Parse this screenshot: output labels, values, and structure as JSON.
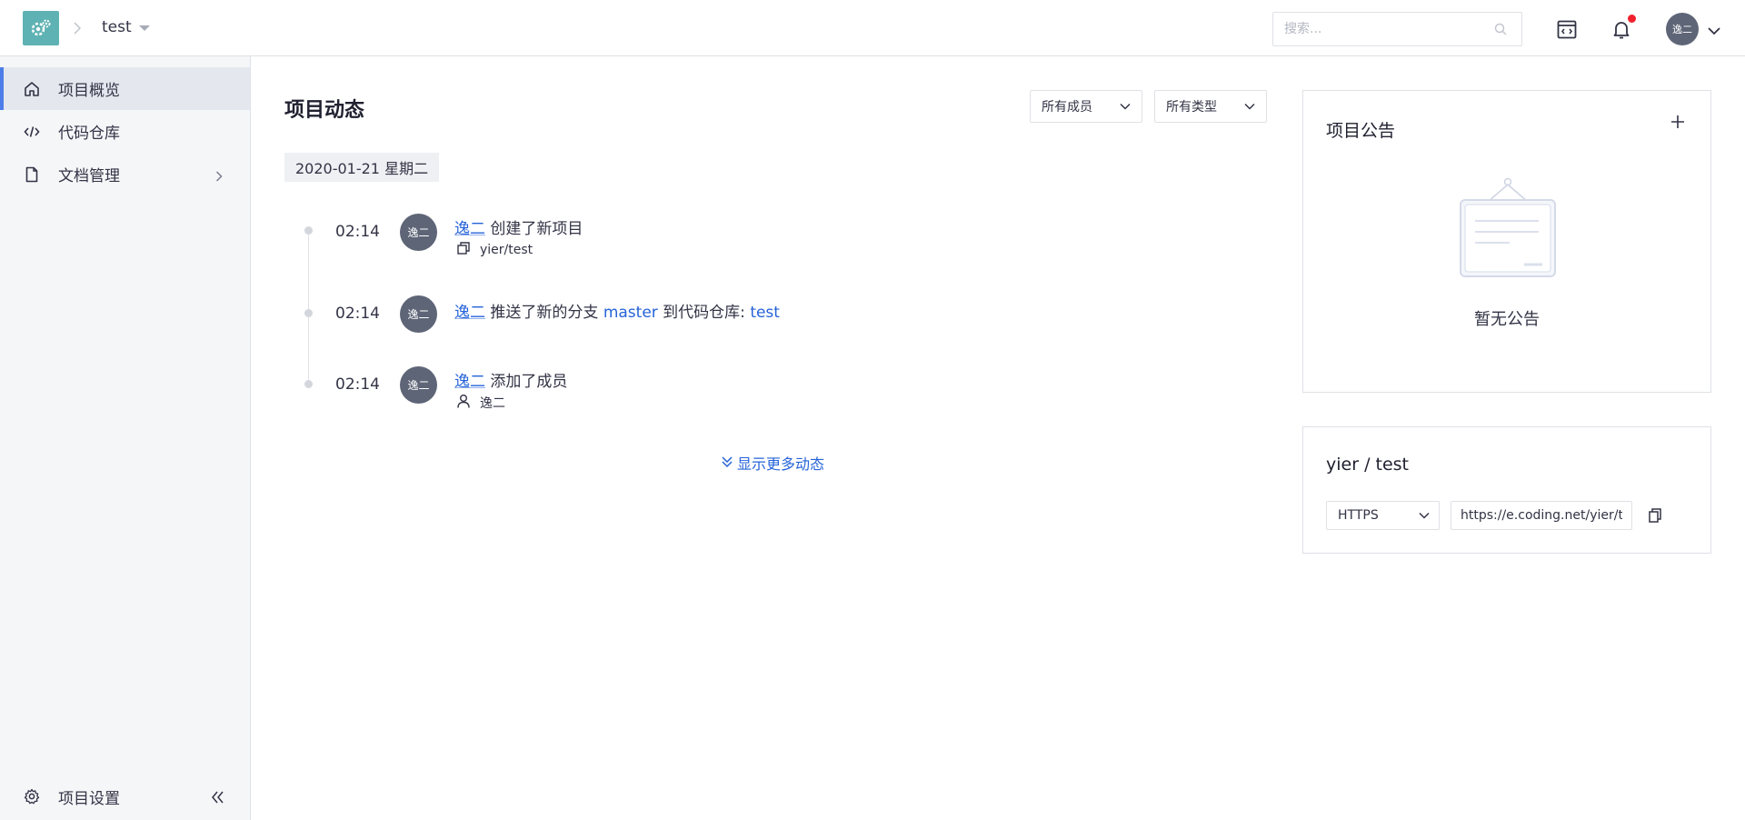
{
  "header": {
    "project_name": "test",
    "search_placeholder": "搜索...",
    "user_avatar": "逸二",
    "icons": [
      "logo-gear-icon",
      "chevron-right-icon",
      "caret-down-icon",
      "search-icon",
      "calendar-icon",
      "bell-icon",
      "chevron-down-icon"
    ],
    "notification_dot_color": "#f0212c"
  },
  "sidebar": {
    "items": [
      {
        "label": "项目概览",
        "icon": "home-icon",
        "active": true
      },
      {
        "label": "代码仓库",
        "icon": "code-icon",
        "active": false
      },
      {
        "label": "文档管理",
        "icon": "document-icon",
        "active": false
      }
    ],
    "footer": {
      "label": "项目设置",
      "icon": "gear-icon"
    },
    "accent_color": "#4d7de8"
  },
  "activity": {
    "title": "项目动态",
    "filters": {
      "members": "所有成员",
      "types": "所有类型"
    },
    "date": "2020-01-21 星期二",
    "entries": [
      {
        "time": "02:14",
        "avatar": "逸二",
        "user": "逸二",
        "action": "创建了新项目",
        "sub": "yier/test"
      },
      {
        "time": "02:14",
        "avatar": "逸二",
        "user": "逸二",
        "action": "推送了新的分支",
        "branch": "master",
        "middle": "到代码仓库:",
        "repo": "test"
      },
      {
        "time": "02:14",
        "avatar": "逸二",
        "user": "逸二",
        "action": "添加了成员",
        "sub": "逸二"
      }
    ],
    "show_more": "显示更多动态",
    "link_color": "#2563d8"
  },
  "announcements": {
    "title": "项目公告",
    "empty_text": "暂无公告"
  },
  "repo_panel": {
    "title": "yier / test",
    "protocol": "HTTPS",
    "url": "https://e.coding.net/yier/test.git"
  }
}
